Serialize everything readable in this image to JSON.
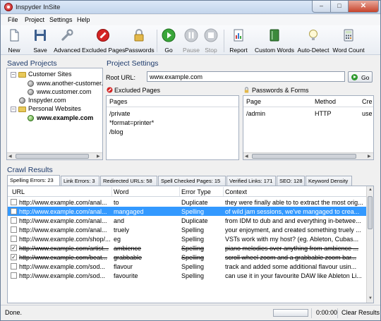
{
  "window": {
    "title": "Inspyder InSite",
    "controls": {
      "min": "–",
      "max": "□",
      "close": "✕"
    }
  },
  "menu": [
    "File",
    "Project",
    "Settings",
    "Help"
  ],
  "toolbar": [
    {
      "label": "New",
      "icon": "new-document-icon",
      "enabled": true
    },
    {
      "label": "Save",
      "icon": "floppy-disk-icon",
      "enabled": true
    },
    {
      "label": "Advanced",
      "icon": "wrench-icon",
      "enabled": true
    },
    {
      "label": "Excluded Pages",
      "icon": "no-entry-icon",
      "enabled": true
    },
    {
      "label": "Passwords",
      "icon": "padlock-icon",
      "enabled": true
    },
    {
      "label": "Go",
      "icon": "play-icon",
      "enabled": true
    },
    {
      "label": "Pause",
      "icon": "pause-icon",
      "enabled": false
    },
    {
      "label": "Stop",
      "icon": "stop-icon",
      "enabled": false
    },
    {
      "label": "Report",
      "icon": "report-icon",
      "enabled": true
    },
    {
      "label": "Custom Words",
      "icon": "book-icon",
      "enabled": true
    },
    {
      "label": "Auto-Detect",
      "icon": "lightbulb-icon",
      "enabled": true
    },
    {
      "label": "Word Count",
      "icon": "calculator-icon",
      "enabled": true
    }
  ],
  "saved_projects": {
    "title": "Saved Projects",
    "tree": [
      {
        "label": "Customer Sites",
        "kind": "folder",
        "expander": "–"
      },
      {
        "label": "www.another-customer.",
        "kind": "site"
      },
      {
        "label": "www.customer.com",
        "kind": "site"
      },
      {
        "label": "Inspyder.com",
        "kind": "site"
      },
      {
        "label": "Personal Websites",
        "kind": "folder",
        "expander": "–"
      },
      {
        "label": "www.example.com",
        "kind": "site-active"
      }
    ]
  },
  "project_settings": {
    "title": "Project Settings",
    "root_url_label": "Root URL:",
    "root_url": "www.example.com",
    "go_label": "Go",
    "excluded": {
      "title": "Excluded Pages",
      "column": "Pages",
      "items": [
        "/private",
        "*format=printer*",
        "/blog"
      ]
    },
    "passwords": {
      "title": "Passwords & Forms",
      "columns": [
        "Page",
        "Method",
        "Cre"
      ],
      "rows": [
        [
          "/admin",
          "HTTP",
          "use"
        ]
      ]
    }
  },
  "crawl": {
    "title": "Crawl Results",
    "tabs": [
      "Spelling Errors: 23",
      "Link Errors: 3",
      "Redirected URLs: 58",
      "Spell Checked Pages: 15",
      "Verified Links: 171",
      "SEO: 128",
      "Keyword Density"
    ],
    "active_tab": 0,
    "columns": [
      "URL",
      "Word",
      "Error Type",
      "Context"
    ],
    "rows": [
      {
        "checked": false,
        "strike": false,
        "url": "http://www.example.com/anal...",
        "word": "to",
        "type": "Duplicate",
        "context": "they were finally able to to extract the most orig..."
      },
      {
        "checked": false,
        "strike": false,
        "selected": true,
        "url": "http://www.example.com/anal...",
        "word": "mangaged",
        "type": "Spelling",
        "context": "of wild jam sessions, we've mangaged to crea..."
      },
      {
        "checked": false,
        "strike": false,
        "url": "http://www.example.com/anal...",
        "word": "and",
        "type": "Duplicate",
        "context": "from IDM to dub and and everything in-betwee..."
      },
      {
        "checked": false,
        "strike": false,
        "url": "http://www.example.com/anal...",
        "word": "truely",
        "type": "Spelling",
        "context": "your enjoyment, and created something truely ..."
      },
      {
        "checked": false,
        "strike": false,
        "url": "http://www.example.com/shop/...",
        "word": "eg",
        "type": "Spelling",
        "context": "VSTs work with my host? (eg. Ableton, Cubas..."
      },
      {
        "checked": true,
        "strike": true,
        "url": "http://www.example.com/artist...",
        "word": "ambience",
        "type": "Spelling",
        "context": "piano melodies over anything from ambience ..."
      },
      {
        "checked": true,
        "strike": true,
        "url": "http://www.example.com/beat...",
        "word": "grabbable",
        "type": "Spelling",
        "context": "scroll wheel zoom and a grabbable zoom bar..."
      },
      {
        "checked": false,
        "strike": false,
        "url": "http://www.example.com/sod...",
        "word": "flavour",
        "type": "Spelling",
        "context": "track and added some additional flavour usin..."
      },
      {
        "checked": false,
        "strike": false,
        "url": "http://www.example.com/sod...",
        "word": "favourite",
        "type": "Spelling",
        "context": "can use it in your favourite DAW like Ableton Li..."
      }
    ]
  },
  "status": {
    "text": "Done.",
    "time": "0:00:00",
    "clear": "Clear Results",
    "progress": 0
  }
}
